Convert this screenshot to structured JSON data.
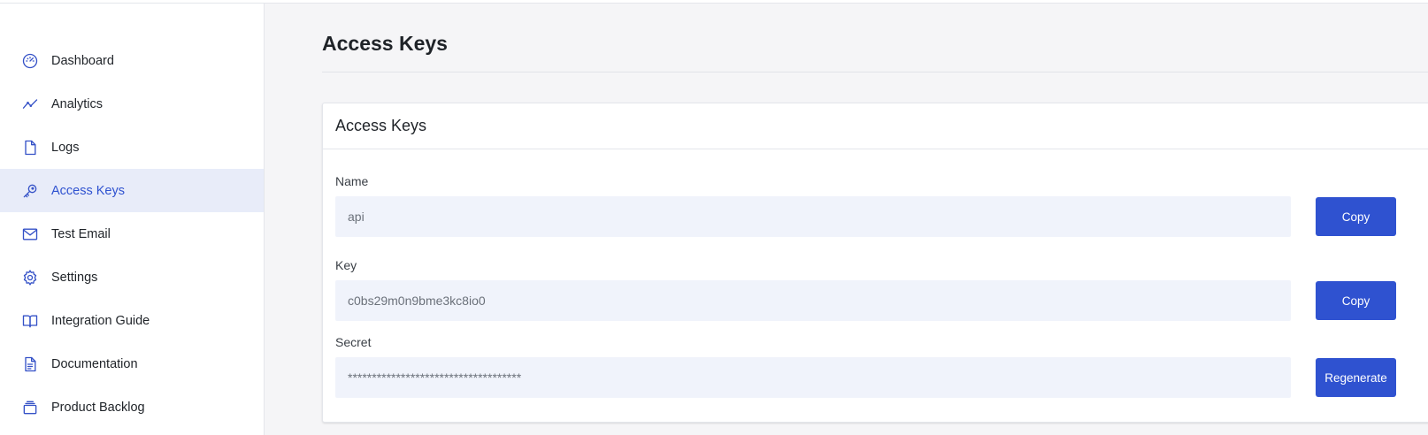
{
  "sidebar": {
    "items": [
      {
        "label": "Dashboard",
        "icon": "dashboard-gauge-icon",
        "active": false
      },
      {
        "label": "Analytics",
        "icon": "analytics-line-icon",
        "active": false
      },
      {
        "label": "Logs",
        "icon": "file-icon",
        "active": false
      },
      {
        "label": "Access Keys",
        "icon": "key-icon",
        "active": true
      },
      {
        "label": "Test Email",
        "icon": "envelope-icon",
        "active": false
      },
      {
        "label": "Settings",
        "icon": "gear-icon",
        "active": false
      },
      {
        "label": "Integration Guide",
        "icon": "open-book-icon",
        "active": false
      },
      {
        "label": "Documentation",
        "icon": "document-icon",
        "active": false
      },
      {
        "label": "Product Backlog",
        "icon": "stack-icon",
        "active": false
      }
    ]
  },
  "main": {
    "title": "Access Keys",
    "card": {
      "title": "Access Keys",
      "fields": [
        {
          "label": "Name",
          "value": "api",
          "button": "Copy"
        },
        {
          "label": "Key",
          "value": "c0bs29m0n9bme3kc8io0",
          "button": "Copy"
        },
        {
          "label": "Secret",
          "value": "************************************",
          "button": "Regenerate"
        }
      ]
    }
  },
  "colors": {
    "accent": "#2f52d0",
    "active_bg": "#e8ecf9",
    "input_bg": "#f0f3fb",
    "page_bg": "#f5f5f7"
  }
}
